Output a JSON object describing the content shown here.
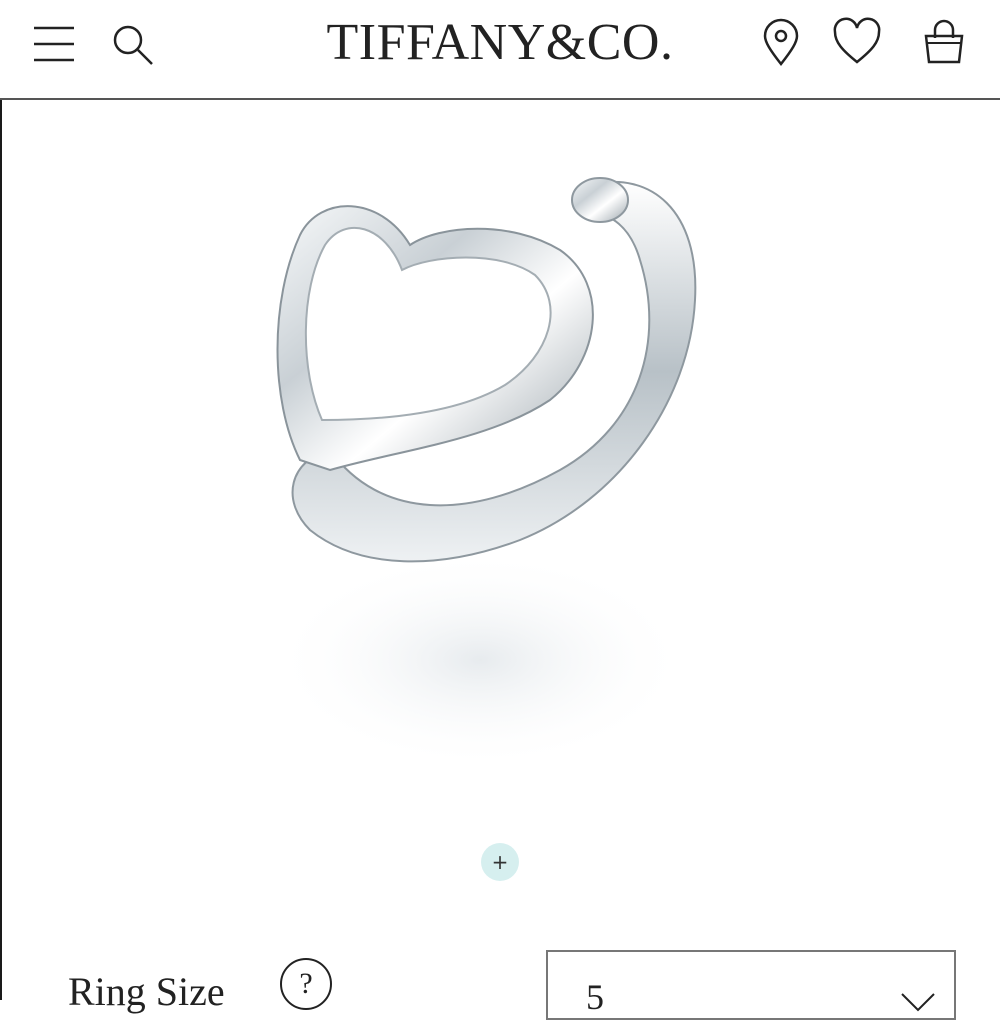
{
  "header": {
    "brand": "TIFFANY&CO.",
    "icons": {
      "menu": "hamburger-menu-icon",
      "search": "search-icon",
      "location": "location-pin-icon",
      "wishlist": "heart-icon",
      "bag": "shopping-bag-icon"
    }
  },
  "product": {
    "image_alt": "Open Heart ring",
    "zoom_symbol": "+",
    "accent": "#d6efef"
  },
  "options": {
    "size_label": "Ring Size",
    "help_symbol": "?",
    "size_value": "5"
  }
}
